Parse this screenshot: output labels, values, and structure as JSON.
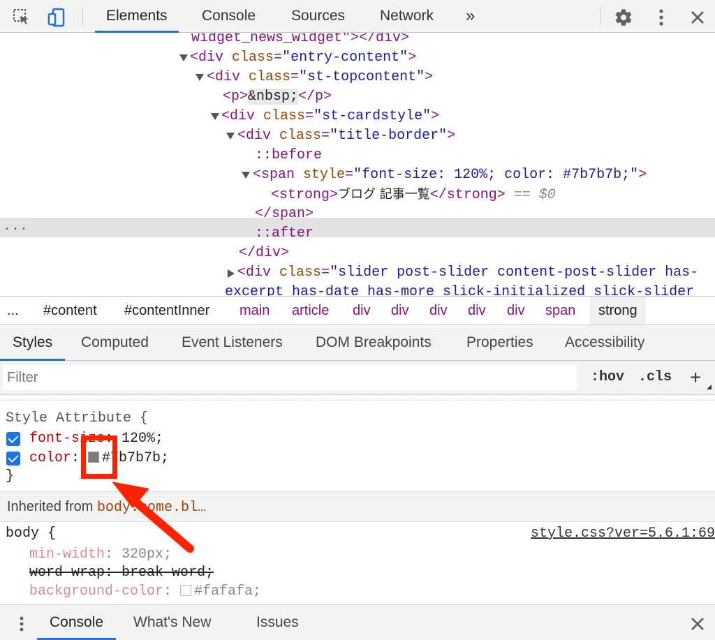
{
  "toolbar": {
    "tabs": [
      "Elements",
      "Console",
      "Sources",
      "Network"
    ],
    "more_tabs": "»",
    "accent_color": "#1a73e8"
  },
  "tree": {
    "lines": {
      "l0": {
        "tag_open": "widget_news_widget\"></div>"
      },
      "l1": {
        "tag": "<div",
        "attr": "class",
        "value": "\"entry-content\"",
        "close": ">"
      },
      "l2": {
        "tag": "<div",
        "attr": "class",
        "value": "\"st-topcontent\"",
        "close": ">"
      },
      "l3": {
        "open": "<p>",
        "text": "&nbsp;",
        "close": "</p>"
      },
      "l4": {
        "tag": "<div",
        "attr": "class",
        "value": "\"st-cardstyle\"",
        "close": ">"
      },
      "l5": {
        "tag": "<div",
        "attr": "class",
        "value": "\"title-border\"",
        "close": ">"
      },
      "l6": {
        "text": "::before"
      },
      "l7": {
        "tag": "<span",
        "attr": "style",
        "value": "\"font-size: 120%; color: #7b7b7b;\"",
        "close": ">"
      },
      "l8": {
        "open": "<strong>",
        "text": "ブログ 記事一覧",
        "close": "</strong>",
        "marker": " == ",
        "var": "$0"
      },
      "l9": {
        "text": "</span>"
      },
      "l10": {
        "text": "::after"
      },
      "l11": {
        "text": "</div>"
      },
      "l12": {
        "tag": "<div",
        "attr": "class",
        "value": "\"slider post-slider content-post-slider has-"
      },
      "l13": {
        "text": "excerpt has-date has-more slick-initialized slick-slider"
      }
    },
    "row_menu": "..."
  },
  "breadcrumbs": {
    "ellipsis": "...",
    "items": [
      "#content",
      "#contentInner",
      "main",
      "article",
      "div",
      "div",
      "div",
      "div",
      "div",
      "span",
      "strong"
    ]
  },
  "subtabs": [
    "Styles",
    "Computed",
    "Event Listeners",
    "DOM Breakpoints",
    "Properties",
    "Accessibility"
  ],
  "filter": {
    "placeholder": "Filter",
    "hov": ":hov",
    "cls": ".cls",
    "add": "+"
  },
  "styles": {
    "style_attr_header": "Style Attribute {",
    "props": [
      {
        "name": "font-size",
        "sep": ": ",
        "value": "120%;"
      },
      {
        "name": "color",
        "sep": ": ",
        "value": "#7b7b7b;",
        "swatch": "#7b7b7b"
      }
    ],
    "close_brace": "}",
    "inherited_label": "Inherited from ",
    "inherited_link": "body.home.bl…",
    "body_selector": "body {",
    "source_link": "style.css?ver=5.6.1:69",
    "body_props": [
      {
        "name": "min-width",
        "sep": ": ",
        "value": "320px;"
      },
      {
        "name": "word-wrap",
        "sep": ": ",
        "value": "break-word;"
      },
      {
        "name": "background-color",
        "sep": ": ",
        "value": "#fafafa;",
        "swatch": "#fafafa"
      }
    ]
  },
  "annotation": {
    "color": "#ff2200"
  },
  "drawer": {
    "tabs": [
      "Console",
      "What's New",
      "Issues"
    ]
  }
}
